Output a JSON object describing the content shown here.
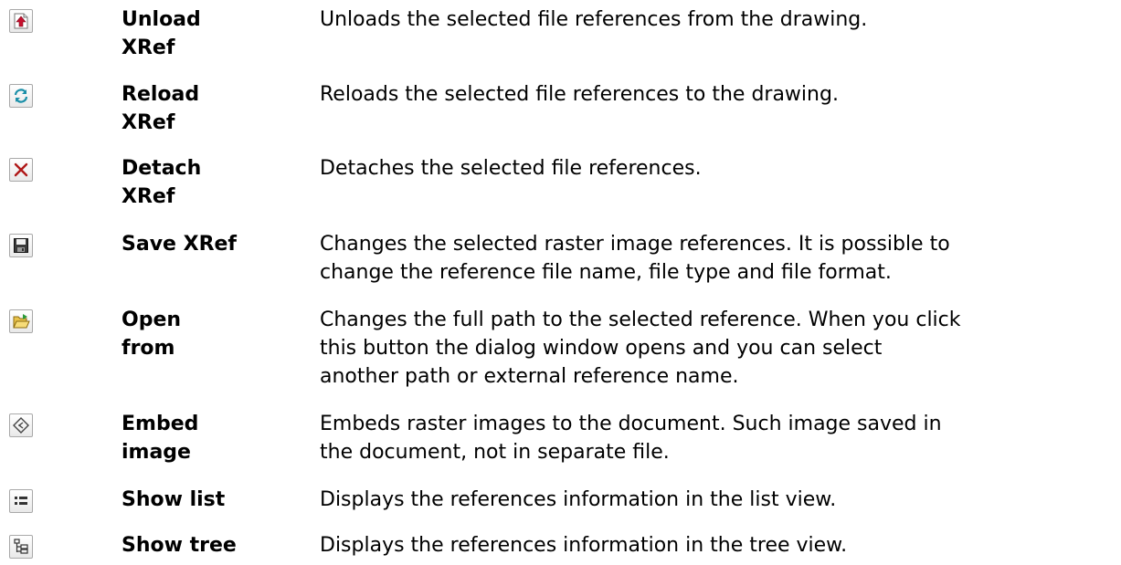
{
  "rows": [
    {
      "icon": "unload-xref-icon",
      "name_lines": [
        "Unload",
        "XRef"
      ],
      "desc_lines": [
        "Unloads the selected file references from the drawing."
      ]
    },
    {
      "icon": "reload-xref-icon",
      "name_lines": [
        "Reload",
        "XRef"
      ],
      "desc_lines": [
        "Reloads the selected file references to the drawing."
      ]
    },
    {
      "icon": "detach-xref-icon",
      "name_lines": [
        "Detach",
        "XRef"
      ],
      "desc_lines": [
        "Detaches the selected file references."
      ]
    },
    {
      "icon": "save-xref-icon",
      "name_lines": [
        "Save XRef"
      ],
      "desc_lines": [
        "Changes the selected raster image references. It is possible to",
        "change the reference file name, file type and file format."
      ]
    },
    {
      "icon": "open-from-icon",
      "name_lines": [
        "Open",
        "from"
      ],
      "desc_lines": [
        "Changes the full path to the selected reference. When you click",
        "this button the dialog window opens and you can select",
        "another path or external reference name."
      ]
    },
    {
      "icon": "embed-image-icon",
      "name_lines": [
        "Embed",
        "image"
      ],
      "desc_lines": [
        "Embeds raster images to the document. Such image saved in",
        "the document, not in separate file."
      ]
    },
    {
      "icon": "show-list-icon",
      "name_lines": [
        "Show list"
      ],
      "desc_lines": [
        "Displays the references information in the list view."
      ]
    },
    {
      "icon": "show-tree-icon",
      "name_lines": [
        "Show tree"
      ],
      "desc_lines": [
        "Displays the references information in the tree view."
      ]
    }
  ]
}
